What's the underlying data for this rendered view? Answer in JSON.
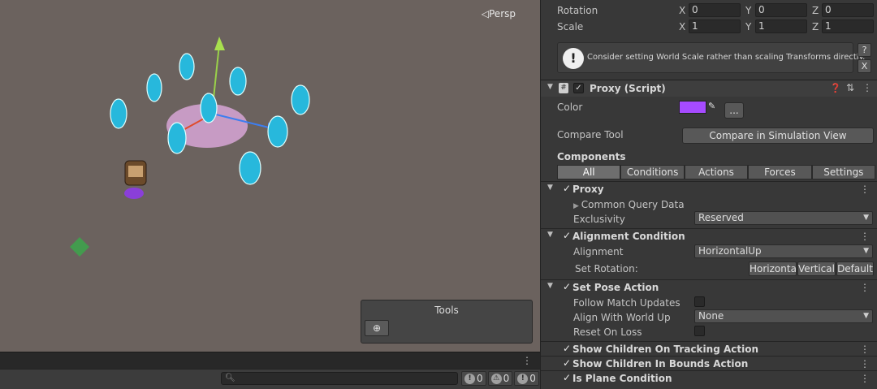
{
  "scene": {
    "persp_label": "Persp",
    "tools": {
      "title": "Tools",
      "button_icon": "tool-settings-icon"
    }
  },
  "console": {
    "search_placeholder": "",
    "counts": [
      {
        "icon": "info-icon",
        "value": "0"
      },
      {
        "icon": "warning-icon",
        "value": "0"
      },
      {
        "icon": "error-icon",
        "value": "0"
      }
    ]
  },
  "transform": {
    "rotation": {
      "label": "Rotation",
      "x": "0",
      "y": "0",
      "z": "0"
    },
    "scale": {
      "label": "Scale",
      "x": "1",
      "y": "1",
      "z": "1"
    },
    "axes": {
      "x": "X",
      "y": "Y",
      "z": "Z"
    },
    "help_text": "Consider setting World Scale rather than scaling Transforms directly.",
    "help_btn": "?",
    "close_btn": "X"
  },
  "proxy_script": {
    "title": "Proxy (Script)",
    "color_label": "Color",
    "color_value": "#a64bff",
    "more_btn": "...",
    "compare_tool_label": "Compare Tool",
    "compare_button": "Compare in Simulation View",
    "components_label": "Components",
    "tabs": [
      "All",
      "Conditions",
      "Actions",
      "Forces",
      "Settings"
    ]
  },
  "proxy": {
    "title": "Proxy",
    "common_query": "Common Query Data",
    "exclusivity_label": "Exclusivity",
    "exclusivity_value": "Reserved"
  },
  "alignment": {
    "title": "Alignment Condition",
    "alignment_label": "Alignment",
    "alignment_value": "HorizontalUp",
    "set_rotation_label": "Set Rotation:",
    "buttons": [
      "Horizontal",
      "Vertical",
      "Default"
    ]
  },
  "set_pose": {
    "title": "Set Pose Action",
    "follow_label": "Follow Match Updates",
    "align_label": "Align With World Up",
    "align_value": "None",
    "reset_label": "Reset On Loss"
  },
  "extra_sections": [
    "Show Children On Tracking Action",
    "Show Children In Bounds Action",
    "Is Plane Condition"
  ]
}
